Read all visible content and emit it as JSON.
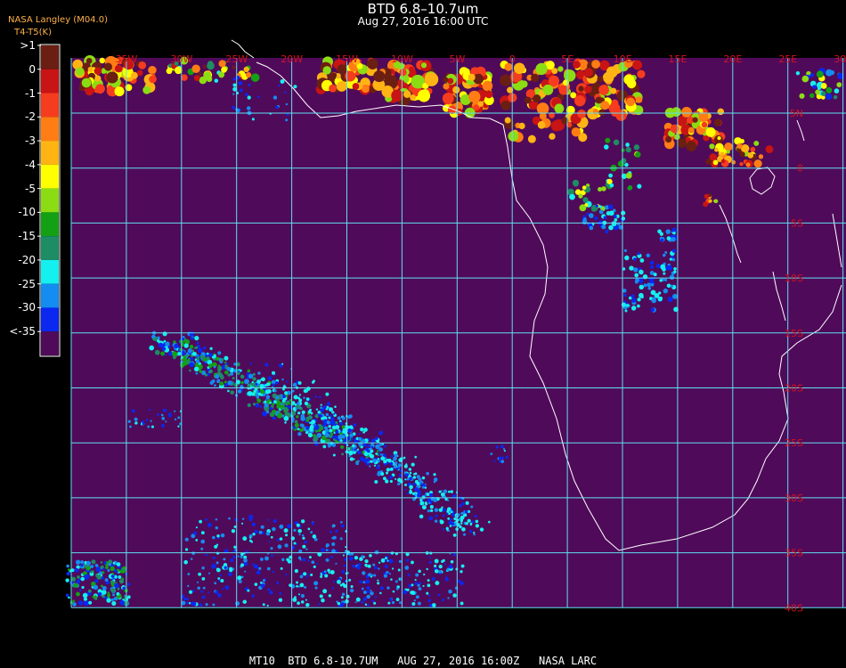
{
  "header": {
    "title": "BTD 6.8–10.7um",
    "subtitle": "Aug 27, 2016 16:00 UTC",
    "credit": "NASA Langley (M04.0)",
    "variable": "T4-T5(K)"
  },
  "legend": {
    "entries": [
      {
        "label": ">1",
        "color": "#6b1f12"
      },
      {
        "label": "0",
        "color": "#c81414"
      },
      {
        "label": "-1",
        "color": "#f53c1e"
      },
      {
        "label": "-2",
        "color": "#ff7d14"
      },
      {
        "label": "-3",
        "color": "#ffb414"
      },
      {
        "label": "-4",
        "color": "#ffff00"
      },
      {
        "label": "-5",
        "color": "#8cdc14"
      },
      {
        "label": "-10",
        "color": "#14a014"
      },
      {
        "label": "-15",
        "color": "#1e8c64"
      },
      {
        "label": "-20",
        "color": "#14f0f0"
      },
      {
        "label": "-25",
        "color": "#148cf0"
      },
      {
        "label": "-30",
        "color": "#0a28f0"
      },
      {
        "label": "<-35",
        "color": "#500a5a"
      }
    ]
  },
  "map": {
    "background_color": "#500a5a",
    "grid_color": "#5fe0f0",
    "label_color": "#d2141e",
    "lon_labels": [
      "35W",
      "30W",
      "25W",
      "20W",
      "15W",
      "10W",
      "5W",
      "0",
      "5E",
      "10E",
      "15E",
      "20E",
      "25E",
      "30E",
      "35E"
    ],
    "lat_labels": [
      "5N",
      "0",
      "5S",
      "10S",
      "15S",
      "20S",
      "25S",
      "30S",
      "35S",
      "40S"
    ]
  },
  "footer": {
    "text": "MT10  BTD 6.8-10.7UM   AUG 27, 2016 16:00Z   NASA LARC"
  }
}
